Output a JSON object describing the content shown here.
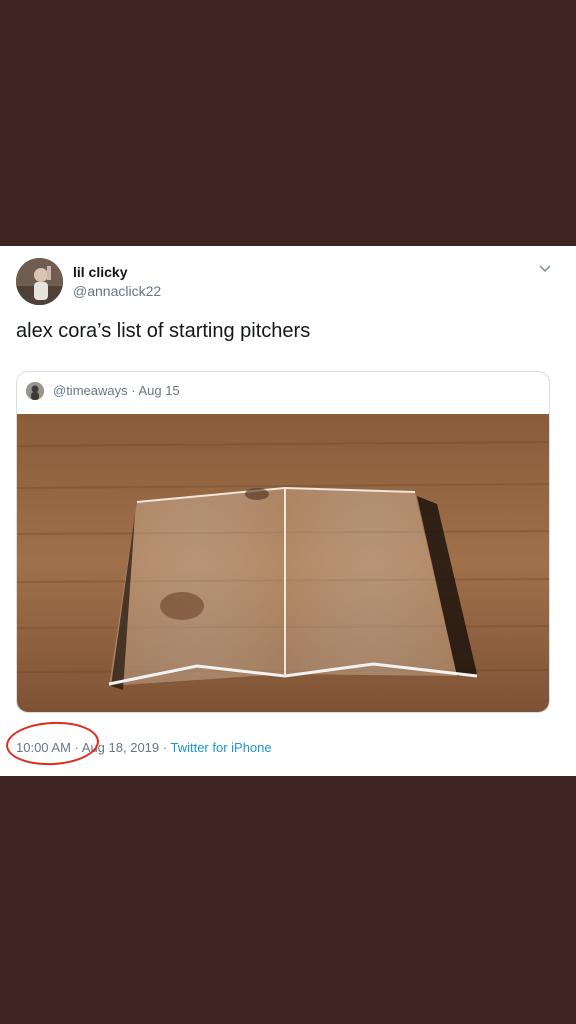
{
  "tweet": {
    "display_name": "lil clicky",
    "handle": "@annaclick22",
    "text": "alex cora’s list of starting pitchers",
    "menu_icon": "chevron-down-icon",
    "quoted": {
      "handle": "@timeaways",
      "separator": " · ",
      "date": "Aug 15"
    },
    "time": "10:00 AM",
    "sep": " · ",
    "date": "Aug 18, 2019",
    "source": "Twitter for iPhone"
  },
  "colors": {
    "background": "#3d2420",
    "annotation_circle": "#e02a1a",
    "link": "#1b95e0"
  }
}
